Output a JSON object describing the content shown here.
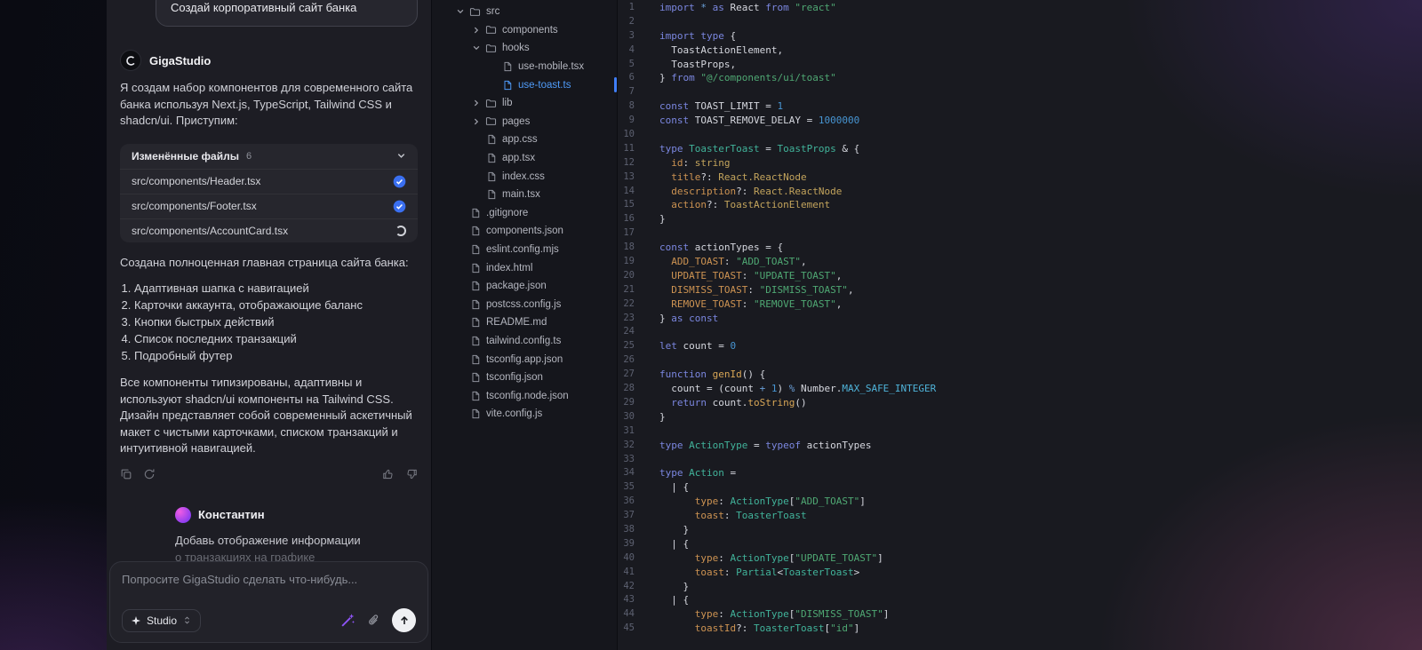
{
  "colors": {
    "accent_blue": "#3a6ff0",
    "selected_file_blue": "#4f9bf8",
    "wand_purple": "#8b5cf6",
    "user_avatar_gradient": [
      "#f05ce3",
      "#8a3cf0"
    ]
  },
  "icons": [
    "gigastudio-logo-icon",
    "chevron-down-icon",
    "chevron-right-icon",
    "folder-icon",
    "file-icon",
    "check-circle-icon",
    "loading-spinner-icon",
    "copy-icon",
    "regenerate-icon",
    "thumbs-up-icon",
    "thumbs-down-icon",
    "sparkles-icon",
    "chevrons-up-down-icon",
    "magic-wand-icon",
    "paperclip-icon",
    "arrow-up-icon"
  ],
  "chat": {
    "top_user_message": "Создай корпоративный сайт банка",
    "assistant": {
      "name": "GigaStudio",
      "intro": "Я создам набор компонентов для современного сайта банка используя Next.js, TypeScript, Tailwind CSS и shadcn/ui. Приступим:",
      "files_panel": {
        "title": "Изменённые файлы",
        "count": "6",
        "files": [
          {
            "name": "src/components/Header.tsx",
            "status": "done"
          },
          {
            "name": "src/components/Footer.tsx",
            "status": "done"
          },
          {
            "name": "src/components/AccountCard.tsx",
            "status": "loading"
          }
        ]
      },
      "summary_intro": "Создана полноценная главная страница сайта банка:",
      "features": [
        "Адаптивная шапка с навигацией",
        "Карточки аккаунта, отображающие баланс",
        "Кнопки быстрых действий",
        "Список последних транзакций",
        "Подробный футер"
      ],
      "outro": "Все компоненты типизированы, адаптивны и используют shadcn/ui компоненты на Tailwind CSS. Дизайн представляет собой современный аскетичный макет с чистыми карточками, списком транзакций и интуитивной навигацией."
    },
    "user_message": {
      "name": "Константин",
      "line1": "Добавь отображение информации",
      "line2": "о транзакциях на графике"
    },
    "composer": {
      "placeholder": "Попросите GigaStudio сделать что-нибудь...",
      "mode": "Studio"
    }
  },
  "file_tree": {
    "rows": [
      {
        "label": "src",
        "type": "folder",
        "expanded": true,
        "depth": 0
      },
      {
        "label": "components",
        "type": "folder",
        "expanded": false,
        "depth": 1
      },
      {
        "label": "hooks",
        "type": "folder",
        "expanded": true,
        "depth": 1
      },
      {
        "label": "use-mobile.tsx",
        "type": "file",
        "depth": 2
      },
      {
        "label": "use-toast.ts",
        "type": "file",
        "depth": 2,
        "selected": true
      },
      {
        "label": "lib",
        "type": "folder",
        "expanded": false,
        "depth": 1
      },
      {
        "label": "pages",
        "type": "folder",
        "expanded": false,
        "depth": 1
      },
      {
        "label": "app.css",
        "type": "file",
        "depth": 1
      },
      {
        "label": "app.tsx",
        "type": "file",
        "depth": 1
      },
      {
        "label": "index.css",
        "type": "file",
        "depth": 1
      },
      {
        "label": "main.tsx",
        "type": "file",
        "depth": 1
      },
      {
        "label": ".gitignore",
        "type": "file",
        "depth": 0
      },
      {
        "label": "components.json",
        "type": "file",
        "depth": 0
      },
      {
        "label": "eslint.config.mjs",
        "type": "file",
        "depth": 0
      },
      {
        "label": "index.html",
        "type": "file",
        "depth": 0
      },
      {
        "label": "package.json",
        "type": "file",
        "depth": 0
      },
      {
        "label": "postcss.config.js",
        "type": "file",
        "depth": 0
      },
      {
        "label": "README.md",
        "type": "file",
        "depth": 0
      },
      {
        "label": "tailwind.config.ts",
        "type": "file",
        "depth": 0
      },
      {
        "label": "tsconfig.app.json",
        "type": "file",
        "depth": 0
      },
      {
        "label": "tsconfig.json",
        "type": "file",
        "depth": 0
      },
      {
        "label": "tsconfig.node.json",
        "type": "file",
        "depth": 0
      },
      {
        "label": "vite.config.js",
        "type": "file",
        "depth": 0
      }
    ]
  },
  "editor": {
    "active_file": "use-toast.ts",
    "lines": [
      [
        [
          "k",
          "import"
        ],
        [
          "p",
          " "
        ],
        [
          "o",
          "*"
        ],
        [
          "p",
          " "
        ],
        [
          "k",
          "as"
        ],
        [
          "p",
          " React "
        ],
        [
          "k",
          "from"
        ],
        [
          "p",
          " "
        ],
        [
          "s",
          "\"react\""
        ]
      ],
      [],
      [
        [
          "k",
          "import"
        ],
        [
          "p",
          " "
        ],
        [
          "k",
          "type"
        ],
        [
          "p",
          " {"
        ]
      ],
      [
        [
          "p",
          "  ToastActionElement,"
        ]
      ],
      [
        [
          "p",
          "  ToastProps,"
        ]
      ],
      [
        [
          "p",
          "} "
        ],
        [
          "k",
          "from"
        ],
        [
          "p",
          " "
        ],
        [
          "s",
          "\"@/components/ui/toast\""
        ]
      ],
      [],
      [
        [
          "k",
          "const"
        ],
        [
          "p",
          " TOAST_LIMIT = "
        ],
        [
          "n",
          "1"
        ]
      ],
      [
        [
          "k",
          "const"
        ],
        [
          "p",
          " TOAST_REMOVE_DELAY = "
        ],
        [
          "n",
          "1000000"
        ]
      ],
      [],
      [
        [
          "k",
          "type"
        ],
        [
          "p",
          " "
        ],
        [
          "t",
          "ToasterToast"
        ],
        [
          "p",
          " = "
        ],
        [
          "t",
          "ToastProps"
        ],
        [
          "p",
          " & {"
        ]
      ],
      [
        [
          "p",
          "  "
        ],
        [
          "a",
          "id"
        ],
        [
          "p",
          ": "
        ],
        [
          "y",
          "string"
        ]
      ],
      [
        [
          "p",
          "  "
        ],
        [
          "a",
          "title"
        ],
        [
          "p",
          "?: "
        ],
        [
          "y",
          "React.ReactNode"
        ]
      ],
      [
        [
          "p",
          "  "
        ],
        [
          "a",
          "description"
        ],
        [
          "p",
          "?: "
        ],
        [
          "y",
          "React.ReactNode"
        ]
      ],
      [
        [
          "p",
          "  "
        ],
        [
          "a",
          "action"
        ],
        [
          "p",
          "?: "
        ],
        [
          "y",
          "ToastActionElement"
        ]
      ],
      [
        [
          "p",
          "}"
        ]
      ],
      [],
      [
        [
          "k",
          "const"
        ],
        [
          "p",
          " actionTypes = {"
        ]
      ],
      [
        [
          "p",
          "  "
        ],
        [
          "a",
          "ADD_TOAST"
        ],
        [
          "p",
          ": "
        ],
        [
          "s",
          "\"ADD_TOAST\""
        ],
        [
          "p",
          ","
        ]
      ],
      [
        [
          "p",
          "  "
        ],
        [
          "a",
          "UPDATE_TOAST"
        ],
        [
          "p",
          ": "
        ],
        [
          "s",
          "\"UPDATE_TOAST\""
        ],
        [
          "p",
          ","
        ]
      ],
      [
        [
          "p",
          "  "
        ],
        [
          "a",
          "DISMISS_TOAST"
        ],
        [
          "p",
          ": "
        ],
        [
          "s",
          "\"DISMISS_TOAST\""
        ],
        [
          "p",
          ","
        ]
      ],
      [
        [
          "p",
          "  "
        ],
        [
          "a",
          "REMOVE_TOAST"
        ],
        [
          "p",
          ": "
        ],
        [
          "s",
          "\"REMOVE_TOAST\""
        ],
        [
          "p",
          ","
        ]
      ],
      [
        [
          "p",
          "} "
        ],
        [
          "k",
          "as"
        ],
        [
          "p",
          " "
        ],
        [
          "k",
          "const"
        ]
      ],
      [],
      [
        [
          "k",
          "let"
        ],
        [
          "p",
          " count = "
        ],
        [
          "n",
          "0"
        ]
      ],
      [],
      [
        [
          "k",
          "function"
        ],
        [
          "p",
          " "
        ],
        [
          "f",
          "genId"
        ],
        [
          "p",
          "() {"
        ]
      ],
      [
        [
          "p",
          "  count = (count "
        ],
        [
          "o",
          "+"
        ],
        [
          "p",
          " "
        ],
        [
          "n",
          "1"
        ],
        [
          "p",
          ") "
        ],
        [
          "o",
          "%"
        ],
        [
          "p",
          " Number."
        ],
        [
          "c",
          "MAX_SAFE_INTEGER"
        ]
      ],
      [
        [
          "p",
          "  "
        ],
        [
          "k",
          "return"
        ],
        [
          "p",
          " count."
        ],
        [
          "f",
          "toString"
        ],
        [
          "p",
          "()"
        ]
      ],
      [
        [
          "p",
          "}"
        ]
      ],
      [],
      [
        [
          "k",
          "type"
        ],
        [
          "p",
          " "
        ],
        [
          "t",
          "ActionType"
        ],
        [
          "p",
          " = "
        ],
        [
          "k",
          "typeof"
        ],
        [
          "p",
          " actionTypes"
        ]
      ],
      [],
      [
        [
          "k",
          "type"
        ],
        [
          "p",
          " "
        ],
        [
          "t",
          "Action"
        ],
        [
          "p",
          " ="
        ]
      ],
      [
        [
          "p",
          "  | {"
        ]
      ],
      [
        [
          "p",
          "      "
        ],
        [
          "a",
          "type"
        ],
        [
          "p",
          ": "
        ],
        [
          "t",
          "ActionType"
        ],
        [
          "p",
          "["
        ],
        [
          "s",
          "\"ADD_TOAST\""
        ],
        [
          "p",
          "]"
        ]
      ],
      [
        [
          "p",
          "      "
        ],
        [
          "a",
          "toast"
        ],
        [
          "p",
          ": "
        ],
        [
          "t",
          "ToasterToast"
        ]
      ],
      [
        [
          "p",
          "    }"
        ]
      ],
      [
        [
          "p",
          "  | {"
        ]
      ],
      [
        [
          "p",
          "      "
        ],
        [
          "a",
          "type"
        ],
        [
          "p",
          ": "
        ],
        [
          "t",
          "ActionType"
        ],
        [
          "p",
          "["
        ],
        [
          "s",
          "\"UPDATE_TOAST\""
        ],
        [
          "p",
          "]"
        ]
      ],
      [
        [
          "p",
          "      "
        ],
        [
          "a",
          "toast"
        ],
        [
          "p",
          ": "
        ],
        [
          "t",
          "Partial"
        ],
        [
          "p",
          "<"
        ],
        [
          "t",
          "ToasterToast"
        ],
        [
          "p",
          ">"
        ]
      ],
      [
        [
          "p",
          "    }"
        ]
      ],
      [
        [
          "p",
          "  | {"
        ]
      ],
      [
        [
          "p",
          "      "
        ],
        [
          "a",
          "type"
        ],
        [
          "p",
          ": "
        ],
        [
          "t",
          "ActionType"
        ],
        [
          "p",
          "["
        ],
        [
          "s",
          "\"DISMISS_TOAST\""
        ],
        [
          "p",
          "]"
        ]
      ],
      [
        [
          "p",
          "      "
        ],
        [
          "a",
          "toastId"
        ],
        [
          "p",
          "?: "
        ],
        [
          "t",
          "ToasterToast"
        ],
        [
          "p",
          "["
        ],
        [
          "s",
          "\"id\""
        ],
        [
          "p",
          "]"
        ]
      ]
    ]
  }
}
